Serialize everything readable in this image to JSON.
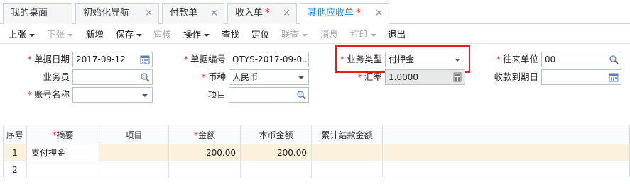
{
  "tabs": [
    {
      "label": "我的桌面",
      "closable": false,
      "modified": false
    },
    {
      "label": "初始化导航",
      "closable": true,
      "modified": false
    },
    {
      "label": "付款单",
      "closable": true,
      "modified": false
    },
    {
      "label": "收入单",
      "closable": true,
      "modified": true
    },
    {
      "label": "其他应收单",
      "closable": true,
      "modified": true,
      "active": true
    }
  ],
  "tab_star": "*",
  "tab_close": "×",
  "toolbar": {
    "prev": "上张",
    "next": "下张",
    "new": "新增",
    "save": "保存",
    "audit": "审核",
    "action": "操作",
    "find": "查找",
    "locate": "定位",
    "linked_query": "联查",
    "message": "消息",
    "print": "打印",
    "exit": "退出"
  },
  "form": {
    "date_label": "单据日期",
    "date_value": "2017-09-12",
    "doc_no_label": "单据编号",
    "doc_no_value": "QTYS-2017-09-0...",
    "biz_type_label": "业务类型",
    "biz_type_value": "付押金",
    "partner_label": "往来单位",
    "partner_value": "00",
    "salesman_label": "业务员",
    "salesman_value": "",
    "currency_label": "币种",
    "currency_value": "人民币",
    "rate_label": "汇率",
    "rate_value": "1.0000",
    "due_date_label": "收款到期日",
    "due_date_value": "",
    "account_label": "账号名称",
    "account_value": "",
    "project_label": "项目",
    "project_value": ""
  },
  "required_mark": "*",
  "grid": {
    "columns": [
      "序号",
      "摘要",
      "项目",
      "金额",
      "本币金额",
      "累计结款金额"
    ],
    "required_columns": [
      1,
      3
    ],
    "rows": [
      {
        "seq": "1",
        "summary": "支付押金",
        "project": "",
        "amount": "200.00",
        "local_amount": "200.00",
        "settled": ""
      },
      {
        "seq": "2",
        "summary": "",
        "project": "",
        "amount": "",
        "local_amount": "",
        "settled": ""
      }
    ]
  },
  "colors": {
    "accent": "#1a8fd8",
    "required": "#e0312a",
    "highlight_box": "#e51c1c",
    "selected_row": "#fbf1dc"
  }
}
